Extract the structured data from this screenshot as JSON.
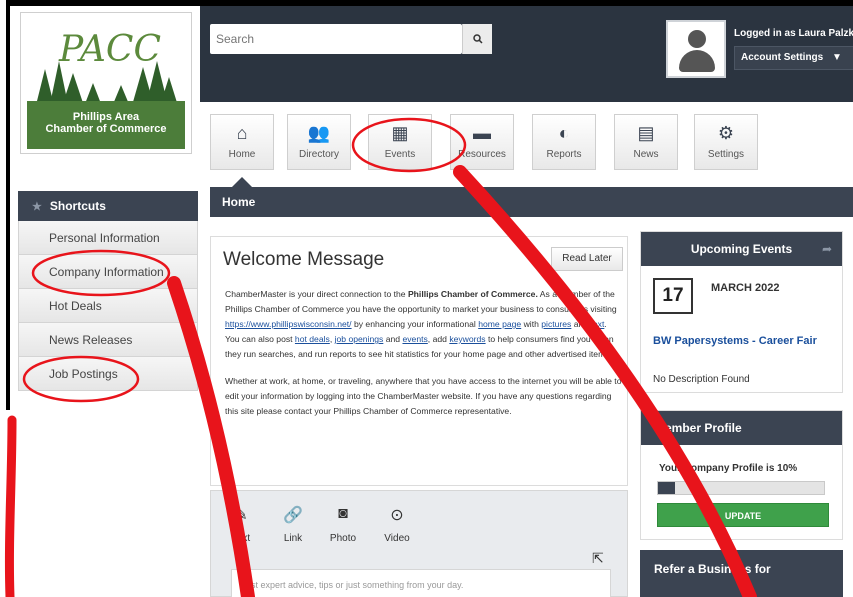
{
  "logo": {
    "script_text": "PACC",
    "org_name_line1": "Phillips Area",
    "org_name_line2": "Chamber of Commerce"
  },
  "search": {
    "placeholder": "Search",
    "icon": "search-icon"
  },
  "user": {
    "logged_in_text": "Logged in as Laura Palzkil",
    "account_settings_label": "Account Settings"
  },
  "nav": {
    "items": [
      {
        "label": "Home",
        "icon": "home-icon"
      },
      {
        "label": "Directory",
        "icon": "people-icon"
      },
      {
        "label": "Events",
        "icon": "calendar-icon"
      },
      {
        "label": "Resources",
        "icon": "folder-icon"
      },
      {
        "label": "Reports",
        "icon": "pie-chart-icon"
      },
      {
        "label": "News",
        "icon": "news-icon"
      },
      {
        "label": "Settings",
        "icon": "gear-icon"
      }
    ]
  },
  "page_title": "Home",
  "shortcuts": {
    "title": "Shortcuts",
    "items": [
      "Personal Information",
      "Company Information",
      "Hot Deals",
      "News Releases",
      "Job Postings"
    ]
  },
  "welcome": {
    "title": "Welcome Message",
    "read_later": "Read Later",
    "p1_a": "ChamberMaster is your direct connection to the ",
    "p1_b": "Phillips Chamber of Commerce.",
    "p1_c": " As a member of the Phillips Chamber of Commerce you have the opportunity to market your business to consumers visiting ",
    "p1_link": "https://www.phillipswisconsin.net/",
    "p1_d": " by enhancing your informational ",
    "p1_home": "home page",
    "p1_e": " with ",
    "p1_pictures": "pictures",
    "p1_f": " and ",
    "p1_text": "text",
    "p1_g": ".  You can also post ",
    "p1_hot": "hot deals",
    "p1_h": ", ",
    "p1_jobs": "job openings",
    "p1_i": " and ",
    "p1_events": "events",
    "p1_j": ", add ",
    "p1_keywords": "keywords",
    "p1_k": " to help consumers find you when they run searches, and run reports to see hit statistics for your home page and other advertised items.",
    "p2": "Whether at work, at home, or traveling, anywhere that you have access to the internet you will be able to edit your information by logging into the ChamberMaster website.  If you have any questions regarding this site please contact your Phillips Chamber of Commerce representative."
  },
  "composer": {
    "tools": [
      {
        "label": "Text",
        "icon": "pencil-icon"
      },
      {
        "label": "Link",
        "icon": "link-icon"
      },
      {
        "label": "Photo",
        "icon": "camera-icon"
      },
      {
        "label": "Video",
        "icon": "play-icon"
      }
    ],
    "placeholder": "Post expert advice, tips or just something from your day."
  },
  "upcoming_events": {
    "title": "Upcoming Events",
    "day": "17",
    "month": "MARCH 2022",
    "event_title": "BW Papersystems - Career Fair",
    "description": "No Description Found"
  },
  "member_profile": {
    "title": "Member Profile",
    "text": "Your Company Profile is 10%",
    "progress_percent": 10,
    "update_label": "UPDATE"
  },
  "refer": {
    "title": "Refer a Business for Membership"
  },
  "annotation_color": "#e8141b",
  "colors": {
    "dark_bar": "#3b4452",
    "header_bg": "#2b3440",
    "link": "#1a4f9c",
    "update_green": "#3fa14b"
  }
}
